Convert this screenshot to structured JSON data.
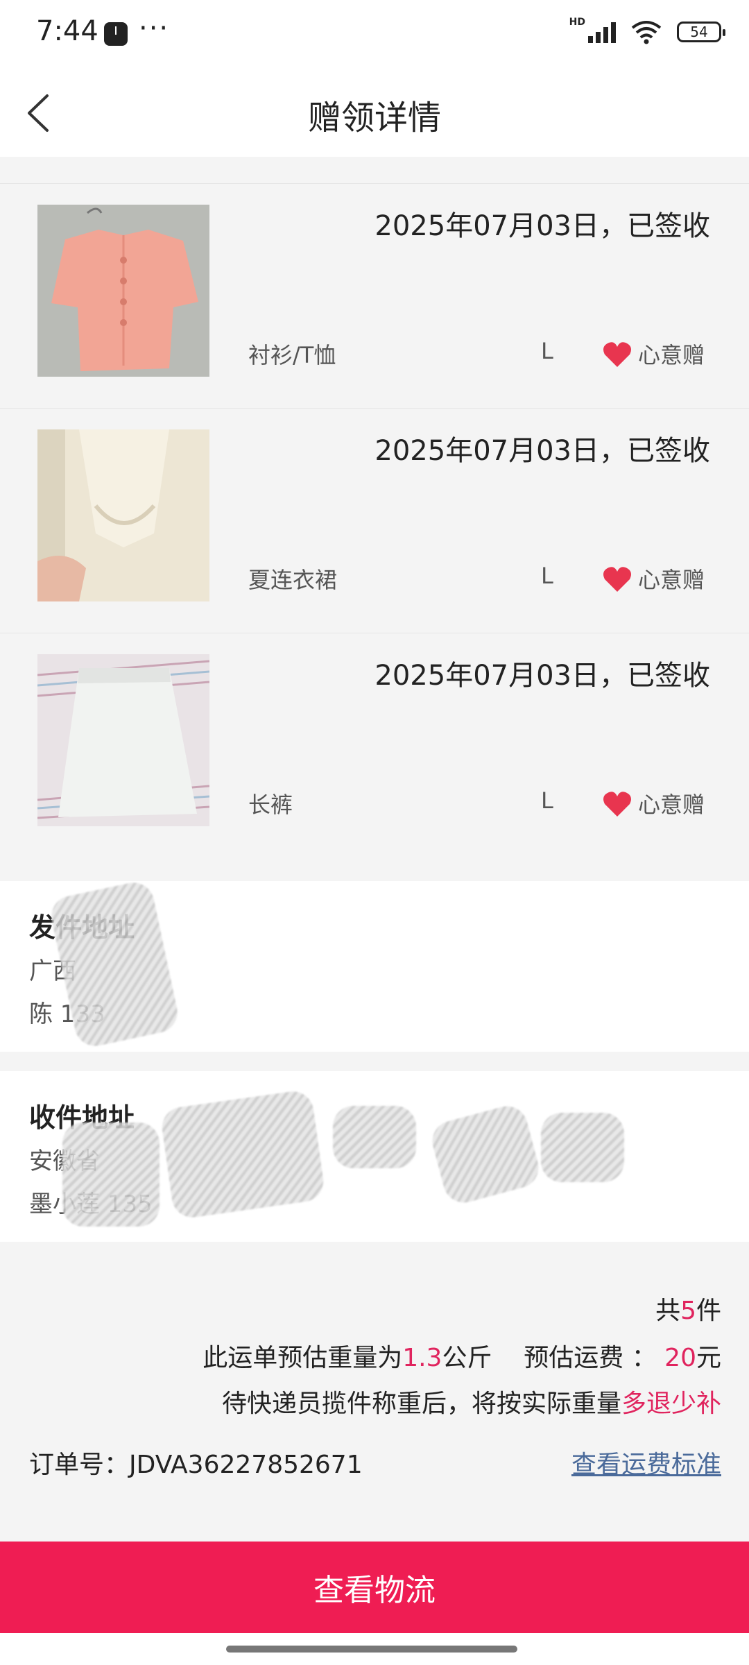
{
  "status_bar": {
    "time": "7:44",
    "dots": "···",
    "hd": "HD",
    "battery": "54"
  },
  "header": {
    "title": "赠领详情"
  },
  "items": [
    {
      "date": "2025年07月03日，已签收",
      "name": "衬衫/T恤",
      "size": "L",
      "tag": "心意赠",
      "color": "#f2a595"
    },
    {
      "date": "2025年07月03日，已签收",
      "name": "夏连衣裙",
      "size": "L",
      "tag": "心意赠",
      "color": "#efe8d8"
    },
    {
      "date": "2025年07月03日，已签收",
      "name": "长裤",
      "size": "L",
      "tag": "心意赠",
      "color": "#e8eaea"
    }
  ],
  "sender": {
    "title": "发件地址",
    "line1": "广西",
    "line2": "陈  133"
  },
  "receiver": {
    "title": "收件地址",
    "line1": "安徽省",
    "line2": "墨小莲  135"
  },
  "summary": {
    "count_prefix": "共",
    "count": "5",
    "count_suffix": "件",
    "weight_prefix": "此运单预估重量为",
    "weight": "1.3",
    "weight_unit": "公斤",
    "fee_label": "预估运费 ：",
    "fee": "20",
    "fee_unit": "元",
    "note_prefix": "待快递员揽件称重后，将按实际重量",
    "note_red": "多退少补"
  },
  "order": {
    "label": "订单号：",
    "number": "JDVA36227852671",
    "fee_link": "查看运费标准"
  },
  "button": {
    "label": "查看物流"
  },
  "colors": {
    "accent": "#ef1d53",
    "red_text": "#e0245e",
    "link": "#4a6a9a",
    "heart": "#e8354f"
  }
}
